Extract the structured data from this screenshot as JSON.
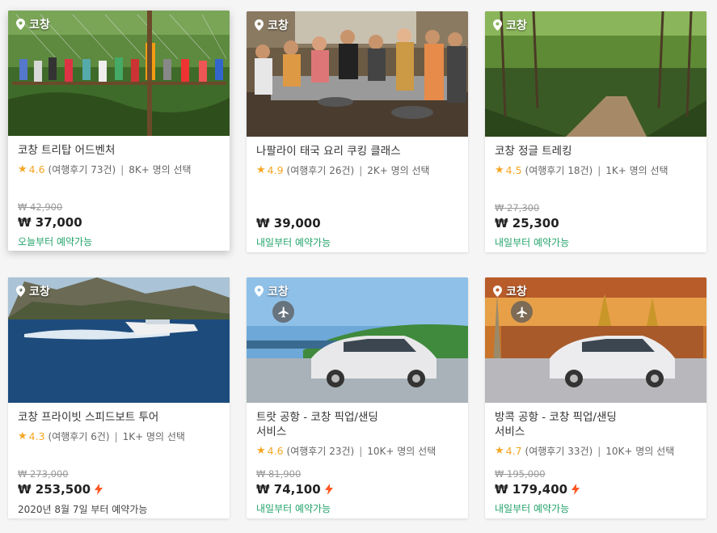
{
  "cards": [
    {
      "location": "코창",
      "title_line1": "코창 트리탑 어드벤처",
      "title_line2": "",
      "rating": "4.6",
      "reviews": "(여행후기 73건)",
      "popularity": "8K+ 명의 선택",
      "old_price": "₩ 42,900",
      "price": "₩ 37,000",
      "availability": "오늘부터 예약가능",
      "instant": false
    },
    {
      "location": "코창",
      "title_line1": "나팔라이 태국 요리 쿠킹 클래스",
      "title_line2": "",
      "rating": "4.9",
      "reviews": "(여행후기 26건)",
      "popularity": "2K+ 명의 선택",
      "old_price": "",
      "price": "₩ 39,000",
      "availability": "내일부터 예약가능",
      "instant": false
    },
    {
      "location": "코창",
      "title_line1": "코창 정글 트레킹",
      "title_line2": "",
      "rating": "4.5",
      "reviews": "(여행후기 18건)",
      "popularity": "1K+ 명의 선택",
      "old_price": "₩ 27,300",
      "price": "₩ 25,300",
      "availability": "내일부터 예약가능",
      "instant": false
    },
    {
      "location": "코창",
      "title_line1": "코창 프라이빗 스피드보트 투어",
      "title_line2": "",
      "rating": "4.3",
      "reviews": "(여행후기 6건)",
      "popularity": "1K+ 명의 선택",
      "old_price": "₩ 273,000",
      "price": "₩ 253,500",
      "availability": "2020년 8월 7일 부터 예약가능",
      "instant": true
    },
    {
      "location": "코창",
      "title_line1": "트랏 공항 - 코창 픽업/샌딩",
      "title_line2": "서비스",
      "rating": "4.6",
      "reviews": "(여행후기 23건)",
      "popularity": "10K+ 명의 선택",
      "old_price": "₩ 81,900",
      "price": "₩ 74,100",
      "availability": "내일부터 예약가능",
      "instant": true
    },
    {
      "location": "코창",
      "title_line1": "방콕 공항 - 코창 픽업/샌딩",
      "title_line2": "서비스",
      "rating": "4.7",
      "reviews": "(여행후기 33건)",
      "popularity": "10K+ 명의 선택",
      "old_price": "₩ 195,000",
      "price": "₩ 179,400",
      "availability": "내일부터 예약가능",
      "instant": true
    }
  ],
  "colors": {
    "rating": "#f5a623",
    "available": "#23a36b",
    "instant": "#ff5722"
  }
}
